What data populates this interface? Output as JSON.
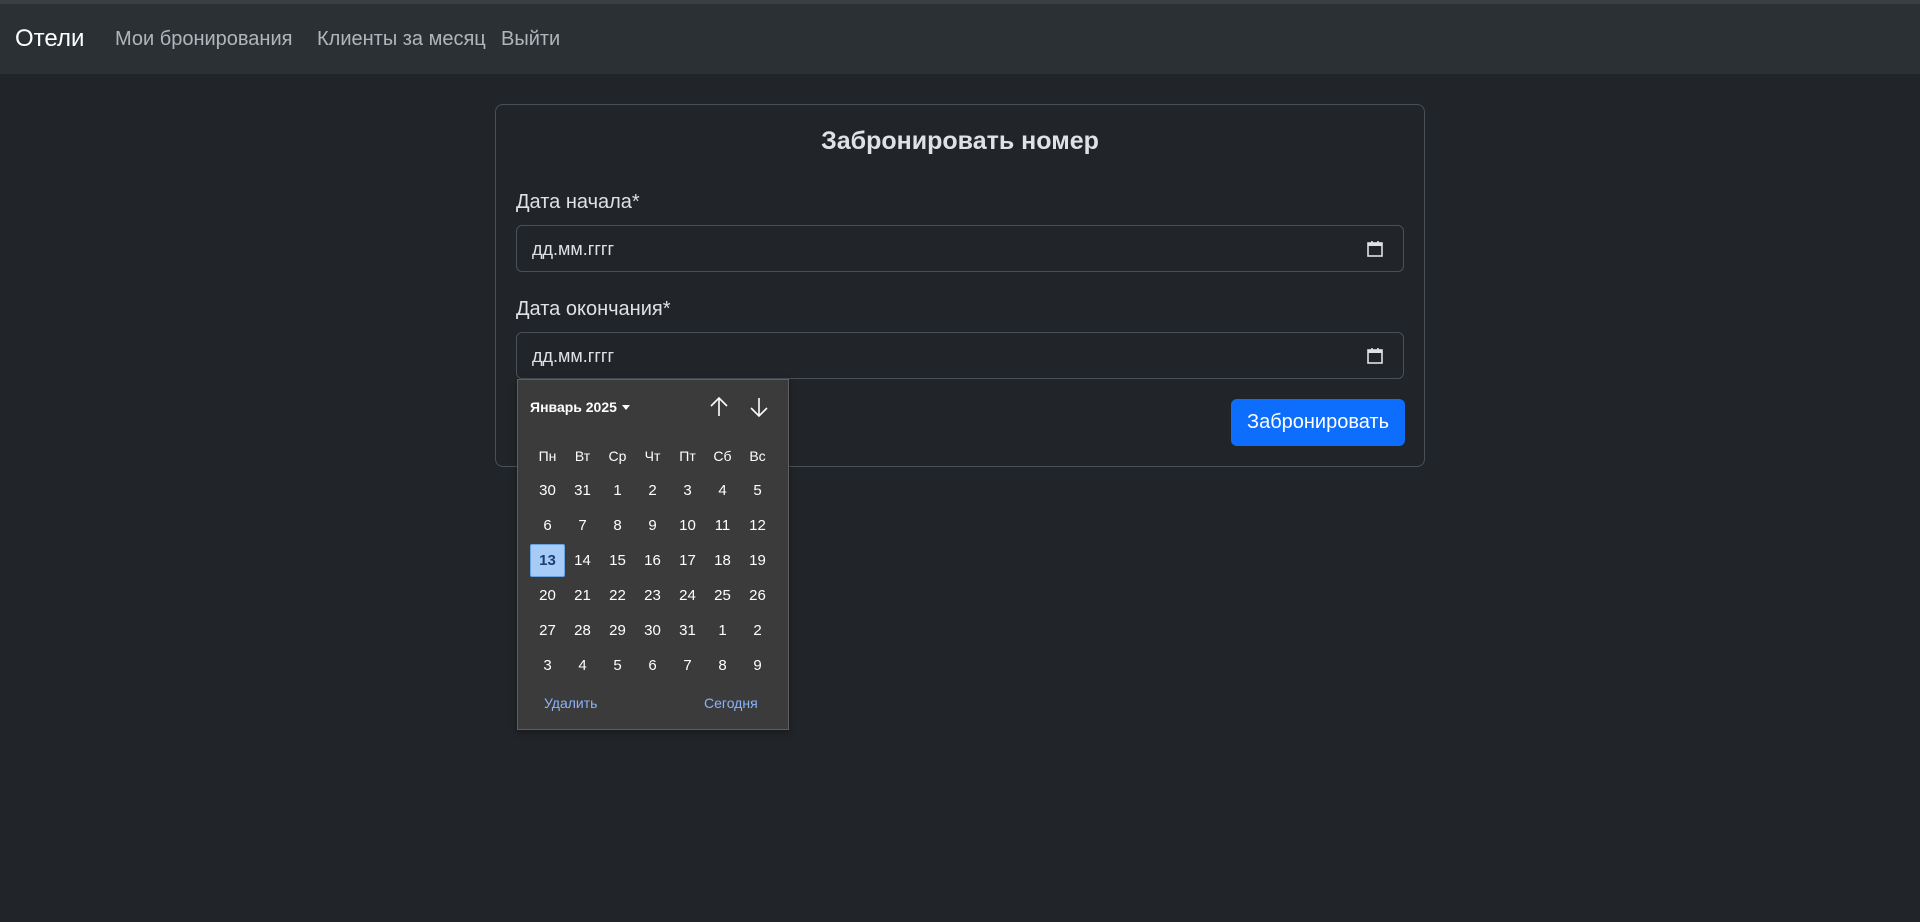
{
  "navbar": {
    "brand": "Отели",
    "links": [
      "Мои бронирования",
      "Клиенты за месяц",
      "Выйти"
    ]
  },
  "form": {
    "title": "Забронировать номер",
    "start_label": "Дата начала*",
    "start_value": "дд.мм.гггг",
    "end_label": "Дата окончания*",
    "end_value": "дд.мм.гггг",
    "submit_label": "Забронировать"
  },
  "datepicker": {
    "month_label": "Январь 2025",
    "weekdays": [
      "Пн",
      "Вт",
      "Ср",
      "Чт",
      "Пт",
      "Сб",
      "Вс"
    ],
    "weeks": [
      [
        "30",
        "31",
        "1",
        "2",
        "3",
        "4",
        "5"
      ],
      [
        "6",
        "7",
        "8",
        "9",
        "10",
        "11",
        "12"
      ],
      [
        "13",
        "14",
        "15",
        "16",
        "17",
        "18",
        "19"
      ],
      [
        "20",
        "21",
        "22",
        "23",
        "24",
        "25",
        "26"
      ],
      [
        "27",
        "28",
        "29",
        "30",
        "31",
        "1",
        "2"
      ],
      [
        "3",
        "4",
        "5",
        "6",
        "7",
        "8",
        "9"
      ]
    ],
    "selected_day": "13",
    "clear_label": "Удалить",
    "today_label": "Сегодня"
  },
  "colors": {
    "background": "#212529",
    "navbar": "#2b3035",
    "accent": "#0d6efd",
    "picker_background": "#3b3b3b",
    "selected_day": "#a6cbf6",
    "link": "#8ab4f8"
  },
  "icons": [
    "calendar-icon",
    "arrow-up-icon",
    "arrow-down-icon",
    "caret-down-icon"
  ]
}
